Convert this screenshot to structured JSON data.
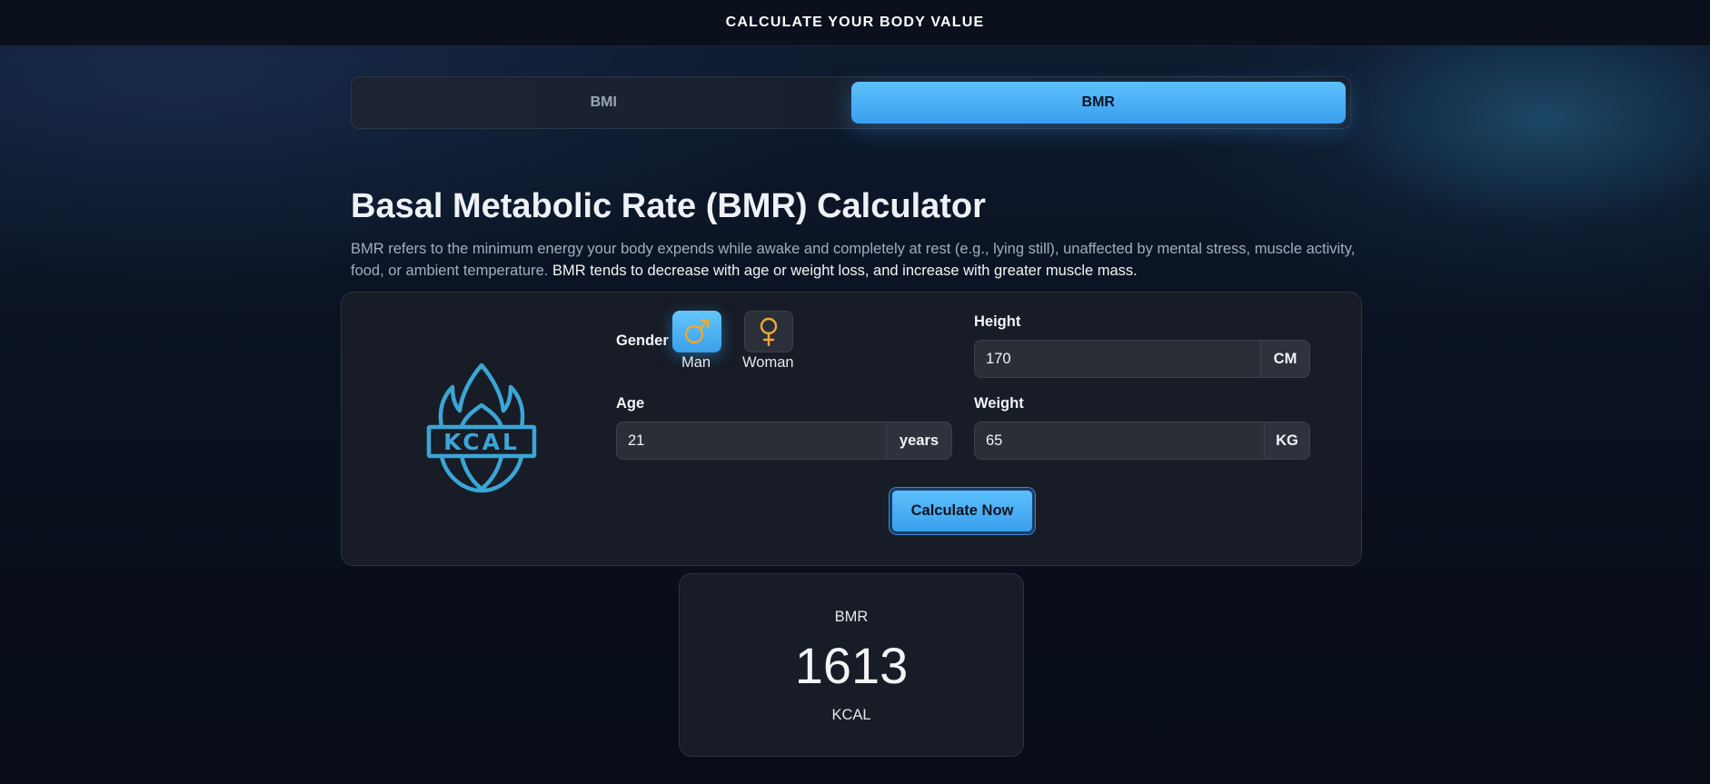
{
  "header": {
    "title": "CALCULATE YOUR BODY VALUE"
  },
  "tabs": [
    {
      "label": "BMI",
      "active": false
    },
    {
      "label": "BMR",
      "active": true
    }
  ],
  "main": {
    "title": "Basal Metabolic Rate (BMR) Calculator",
    "description": "BMR refers to the minimum energy your body expends while awake and completely at rest (e.g., lying still), unaffected by mental stress, muscle activity, food, or ambient temperature.",
    "description_emphasis": "BMR tends to decrease with age or weight loss, and increase with greater muscle mass."
  },
  "form": {
    "icon": "kcal-flame-icon",
    "icon_text": "KCAL",
    "gender_label": "Gender",
    "gender_options": [
      {
        "label": "Man",
        "icon": "male-icon",
        "selected": true
      },
      {
        "label": "Woman",
        "icon": "female-icon",
        "selected": false
      }
    ],
    "height": {
      "label": "Height",
      "value": "170",
      "unit": "CM"
    },
    "age": {
      "label": "Age",
      "value": "21",
      "unit": "years"
    },
    "weight": {
      "label": "Weight",
      "value": "65",
      "unit": "KG"
    },
    "submit_label": "Calculate Now"
  },
  "result": {
    "label": "BMR",
    "value": "1613",
    "unit": "KCAL"
  },
  "colors": {
    "accent": "#4db3f5",
    "icon_blue": "#3aa6d6",
    "gender_symbol": "#f0a830",
    "background": "#0a0f1a",
    "card": "#171c26"
  }
}
